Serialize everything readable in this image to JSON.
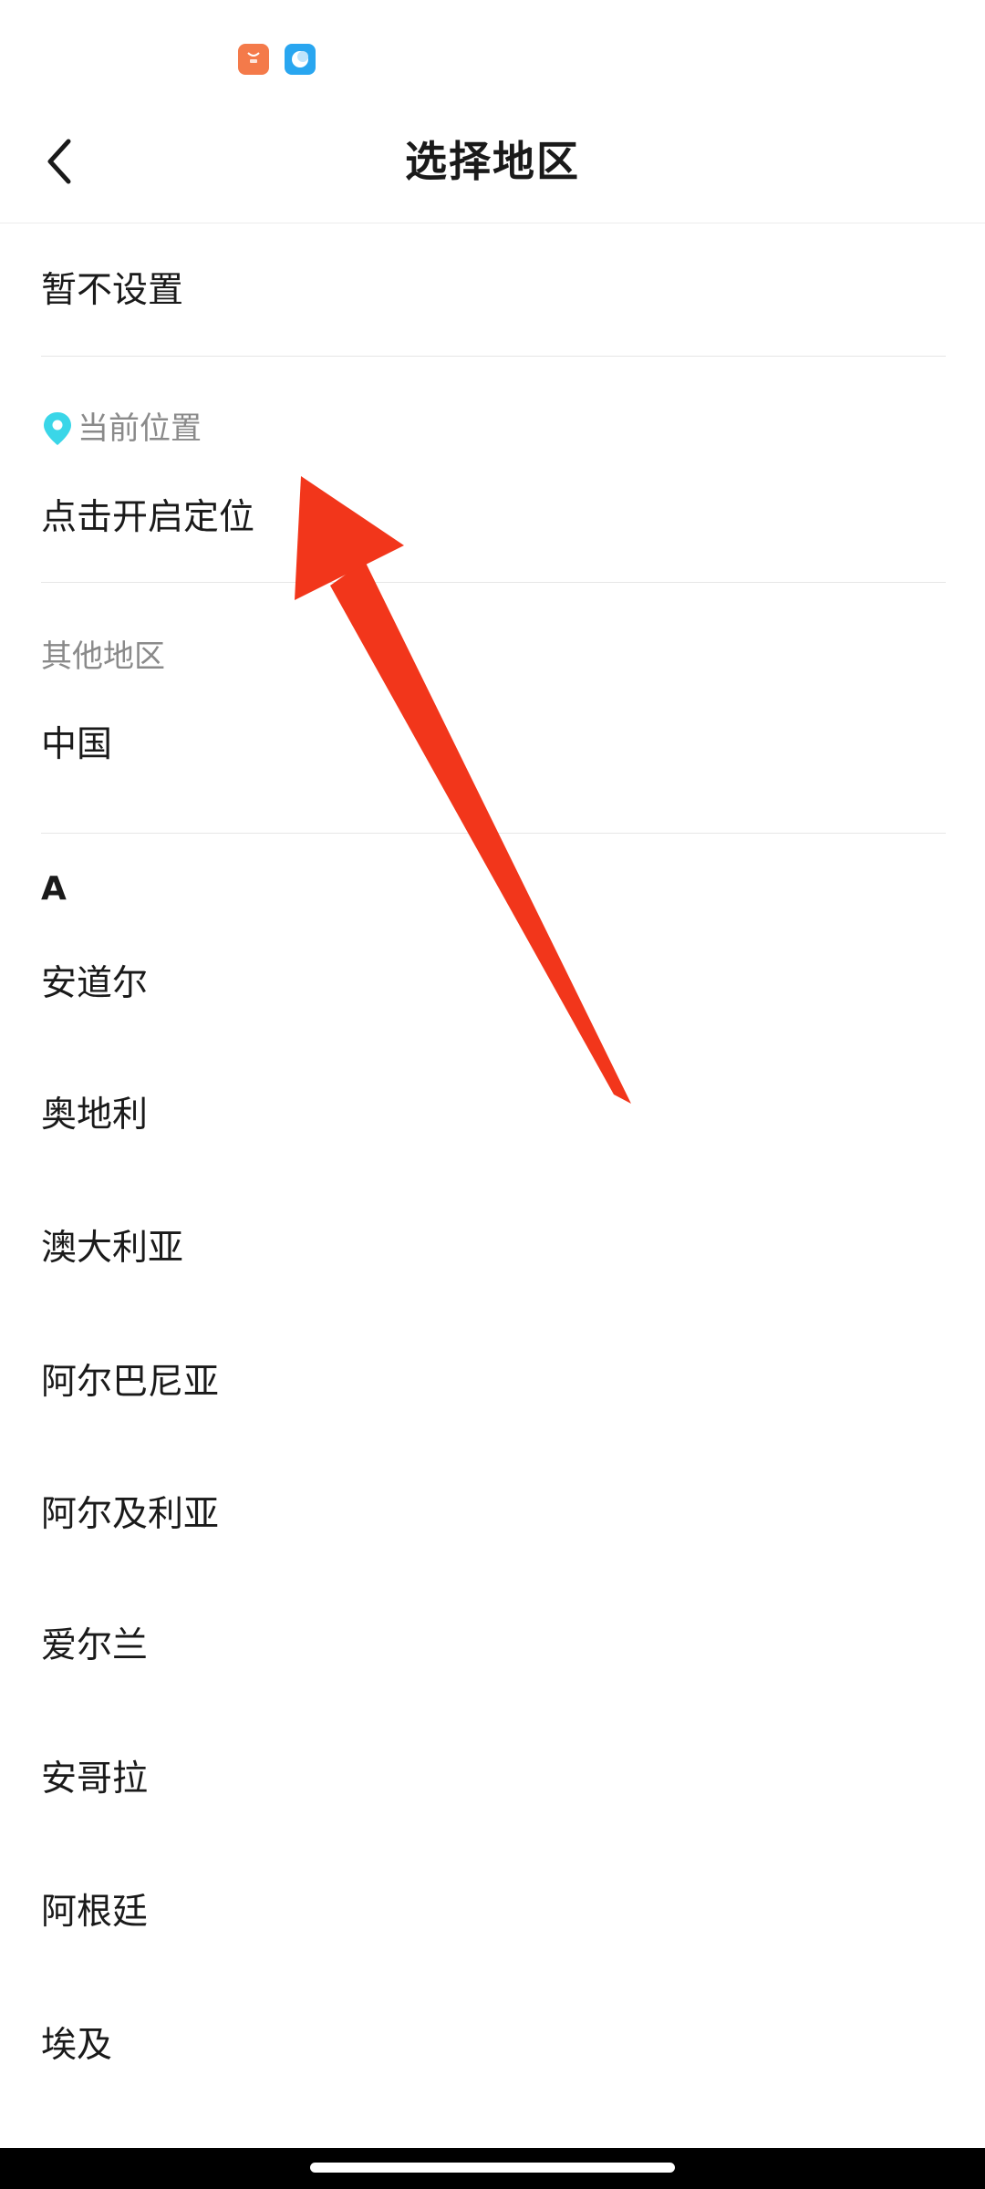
{
  "status_bar": {
    "icons": [
      "shopping-app-icon",
      "browser-app-icon"
    ]
  },
  "header": {
    "title": "选择地区",
    "back_icon": "chevron-left-icon"
  },
  "not_set": {
    "label": "暂不设置"
  },
  "current_location": {
    "header": "当前位置",
    "icon": "location-pin-icon",
    "icon_color": "#3ad6e8",
    "action_label": "点击开启定位"
  },
  "other_regions": {
    "header": "其他地区",
    "items": [
      "中国"
    ]
  },
  "index_groups": [
    {
      "letter": "A",
      "items": [
        "安道尔",
        "奥地利",
        "澳大利亚",
        "阿尔巴尼亚",
        "阿尔及利亚",
        "爱尔兰",
        "安哥拉",
        "阿根廷",
        "埃及"
      ]
    }
  ],
  "annotation": {
    "type": "arrow",
    "color": "#f2361b"
  },
  "colors": {
    "section_header": "#8a8a8a",
    "divider": "#e6e6e6",
    "text": "#1a1a1a"
  }
}
